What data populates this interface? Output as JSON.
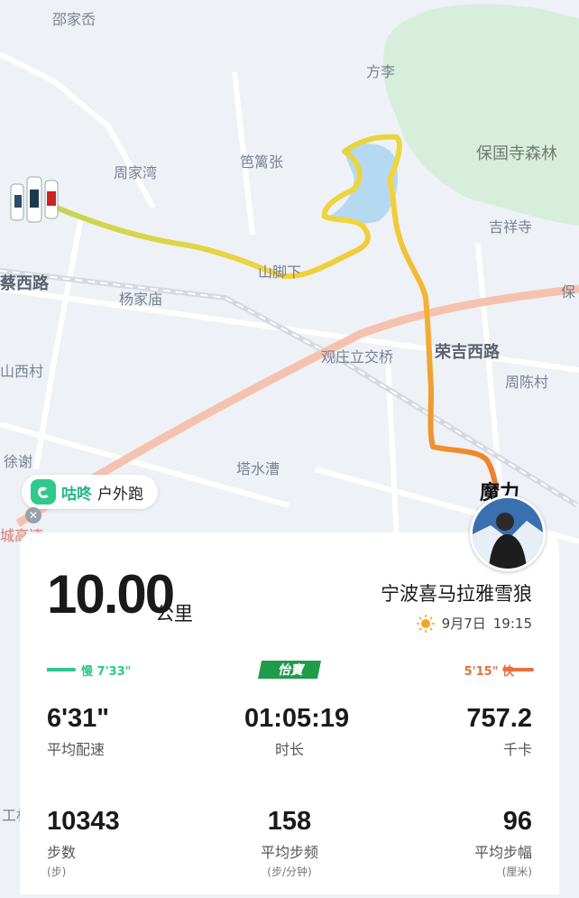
{
  "map": {
    "labels": {
      "shao_jia_xian": "邵家岙",
      "fang_li": "方李",
      "zhou_jia_wan": "周家湾",
      "ba_li_zhang": "笆篱张",
      "bao_guo_si": "保国寺森林",
      "ji_xiang_si": "吉祥寺",
      "shan_jiao_xia": "山脚下",
      "yang_jia_miao": "杨家庙",
      "guan_zhuang": "观庄立交桥",
      "rong_ji_road": "荣吉西路",
      "zhou_chen_cun": "周陈村",
      "xi_road_left": "蔡西路",
      "shan_xi_cun": "山西村",
      "ta_shui_cao": "塔水漕",
      "xu_xie": "徐谢",
      "bao_right": "保",
      "gao_su": "城高速",
      "moli": "魔力",
      "gong_ye": "工杉"
    },
    "route_colors": {
      "start": "#b7d65a",
      "mid": "#f2d437",
      "end": "#f08a2c"
    },
    "lake_color": "#b6d9f2",
    "forest_color": "#d9eedd"
  },
  "badge": {
    "app_name": "咕咚",
    "sport_type": "户外跑",
    "icon": "app-logo-icon",
    "close_icon": "close-icon"
  },
  "summary": {
    "distance": "10.00",
    "distance_unit": "公里",
    "username": "宁波喜马拉雅雪狼",
    "weather_icon": "sun-icon",
    "date": "9月7日",
    "time": "19:15"
  },
  "pace_legend": {
    "slow_label": "慢 7'33\"",
    "fast_label": "5'15\" 快",
    "brand_text": "怡寶",
    "slow_color": "#2cc98a",
    "fast_color": "#e8703c"
  },
  "stats": [
    {
      "value": "6'31\"",
      "label": "平均配速",
      "unit": ""
    },
    {
      "value": "01:05:19",
      "label": "时长",
      "unit": ""
    },
    {
      "value": "757.2",
      "label": "千卡",
      "unit": ""
    },
    {
      "value": "10343",
      "label": "步数",
      "unit": "(步)"
    },
    {
      "value": "158",
      "label": "平均步频",
      "unit": "(步/分钟)"
    },
    {
      "value": "96",
      "label": "平均步幅",
      "unit": "(厘米)"
    }
  ]
}
